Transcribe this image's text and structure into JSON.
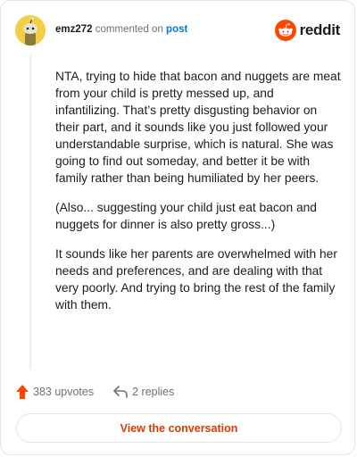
{
  "comment": {
    "username": "emz272",
    "action_text": "commented on",
    "post_link": "post",
    "paragraphs": [
      "NTA, trying to hide that bacon and nuggets are meat from your child is pretty messed up, and infantilizing. That’s pretty disgusting behavior on their part, and it sounds like you just followed your understandable surprise, which is natural. She was going to find out someday, and better it be with family rather than being humiliated by her peers.",
      "(Also... suggesting your child just eat bacon and nuggets for dinner is also pretty gross...)",
      "It sounds like her parents are overwhelmed with her needs and preferences, and are dealing with that very poorly. And trying to bring the rest of the family with them."
    ]
  },
  "brand": {
    "name": "reddit",
    "icon": "reddit-logo-icon",
    "accent": "#ff4500"
  },
  "actions": {
    "upvotes": "383 upvotes",
    "upvote_icon": "upvote-arrow-icon",
    "replies": "2 replies",
    "reply_icon": "reply-arrow-icon"
  },
  "cta": {
    "label": "View the conversation"
  },
  "colors": {
    "link": "#0079d3",
    "cta_text": "#d93a00",
    "upvote": "#ff4500",
    "avatar_bg": "#f2cf44"
  }
}
